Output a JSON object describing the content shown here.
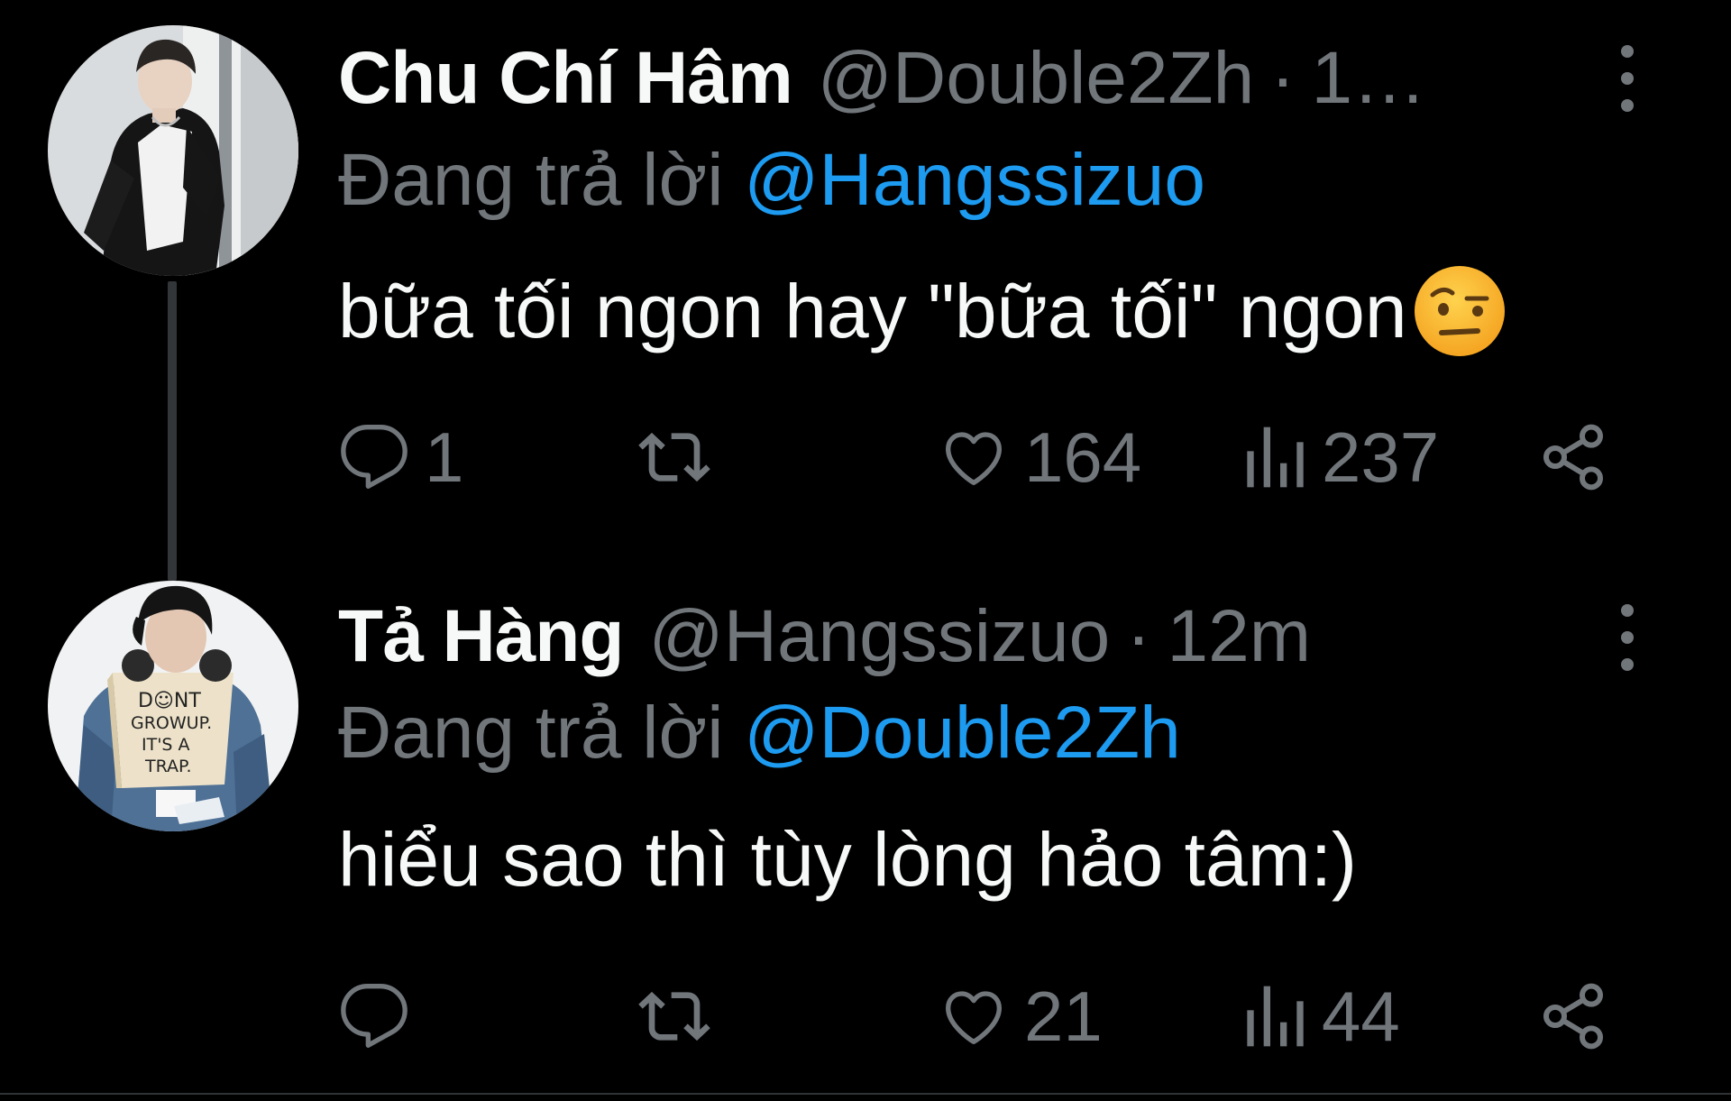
{
  "tweets": [
    {
      "display_name": "Chu Chí Hâm",
      "handle": "@Double2Zh",
      "separator": "·",
      "time": "1…",
      "reply_prefix": "Đang trả lời",
      "reply_to": "@Hangssizuo",
      "text": "bữa tối ngon hay \"bữa tối\" ngon",
      "emoji": "face-with-raised-eyebrow",
      "reply_count": "1",
      "retweet_count": "",
      "like_count": "164",
      "view_count": "237"
    },
    {
      "display_name": "Tả Hàng",
      "handle": "@Hangssizuo",
      "separator": "·",
      "time": "12m",
      "reply_prefix": "Đang trả lời",
      "reply_to": "@Double2Zh",
      "text": "hiểu sao thì tùy lòng hảo tâm:)",
      "reply_count": "",
      "retweet_count": "",
      "like_count": "21",
      "view_count": "44"
    }
  ],
  "avatar_2_shirt_text": "DONT GROW UP. IT'S A TRAP.",
  "icons": {
    "reply": "speech-bubble-icon",
    "retweet": "retweet-arrows-icon",
    "like": "heart-icon",
    "views": "bar-chart-icon",
    "share": "share-nodes-icon",
    "more": "vertical-dots-icon"
  },
  "colors": {
    "background": "#000000",
    "name": "#f7f9f9",
    "secondary": "#71767b",
    "mention": "#1d9bf0",
    "thread_line": "#333639"
  }
}
